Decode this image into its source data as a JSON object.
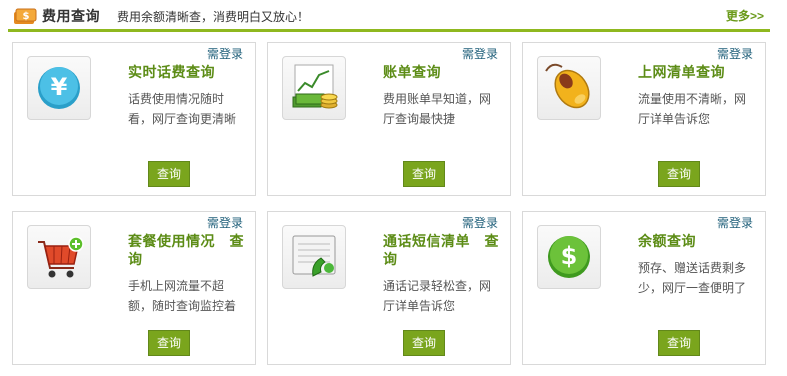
{
  "header": {
    "title": "费用查询",
    "subtitle": "费用余额清晰查，消费明白又放心！",
    "more_label": "更多>>"
  },
  "cards": [
    {
      "login_label": "需登录",
      "title": "实时话费查询",
      "desc": "话费使用情况随时看，网厅查询更清晰",
      "button_label": "查询",
      "icon": "yen-coin-icon"
    },
    {
      "login_label": "需登录",
      "title": "账单查询",
      "desc": "费用账单早知道，网厅查询最快捷",
      "button_label": "查询",
      "icon": "bill-chart-icon"
    },
    {
      "login_label": "需登录",
      "title": "上网清单查询",
      "desc": "流量使用不清晰，网厅详单告诉您",
      "button_label": "查询",
      "icon": "mouse-icon"
    },
    {
      "login_label": "需登录",
      "title": "套餐使用情况　查询",
      "desc": "手机上网流量不超额，随时查询监控着",
      "button_label": "查询",
      "icon": "shopping-cart-icon"
    },
    {
      "login_label": "需登录",
      "title": "通话短信清单　查询",
      "desc": "通话记录轻松查，网厅详单告诉您",
      "button_label": "查询",
      "icon": "phone-list-icon"
    },
    {
      "login_label": "需登录",
      "title": "余额查询",
      "desc": "预存、赠送话费剩多少，网厅一查便明了",
      "button_label": "查询",
      "icon": "dollar-coin-icon"
    }
  ],
  "colors": {
    "accent": "#8fb81f",
    "title_green": "#5c8c16",
    "button_green": "#7aa51d",
    "login_blue": "#1f5f7a"
  }
}
